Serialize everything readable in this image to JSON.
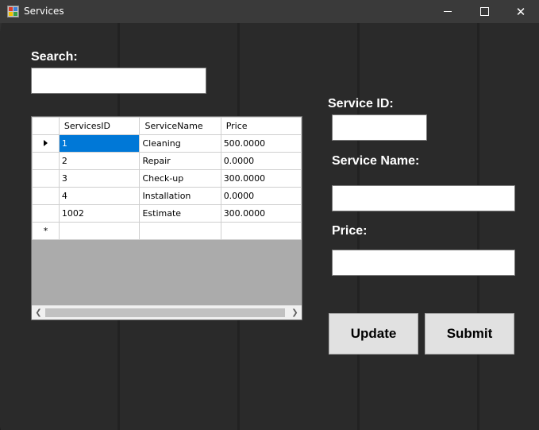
{
  "window": {
    "title": "Services",
    "controls": {
      "minimize": "minimize",
      "maximize": "maximize",
      "close": "✕"
    }
  },
  "search": {
    "label": "Search:",
    "value": ""
  },
  "form": {
    "service_id_label": "Service ID:",
    "service_id_value": "",
    "service_name_label": "Service Name:",
    "service_name_value": "",
    "price_label": "Price:",
    "price_value": ""
  },
  "buttons": {
    "update": "Update",
    "submit": "Submit"
  },
  "grid": {
    "columns": [
      "ServicesID",
      "ServiceName",
      "Price"
    ],
    "rows": [
      {
        "id": "1",
        "name": "Cleaning",
        "price": "500.0000"
      },
      {
        "id": "2",
        "name": "Repair",
        "price": "0.0000"
      },
      {
        "id": "3",
        "name": "Check-up",
        "price": "300.0000"
      },
      {
        "id": "4",
        "name": "Installation",
        "price": "0.0000"
      },
      {
        "id": "1002",
        "name": "Estimate",
        "price": "300.0000"
      }
    ],
    "new_row_marker": "*",
    "current_row_icon": "current-row-arrow-icon",
    "selection_color": "#0078d7"
  }
}
